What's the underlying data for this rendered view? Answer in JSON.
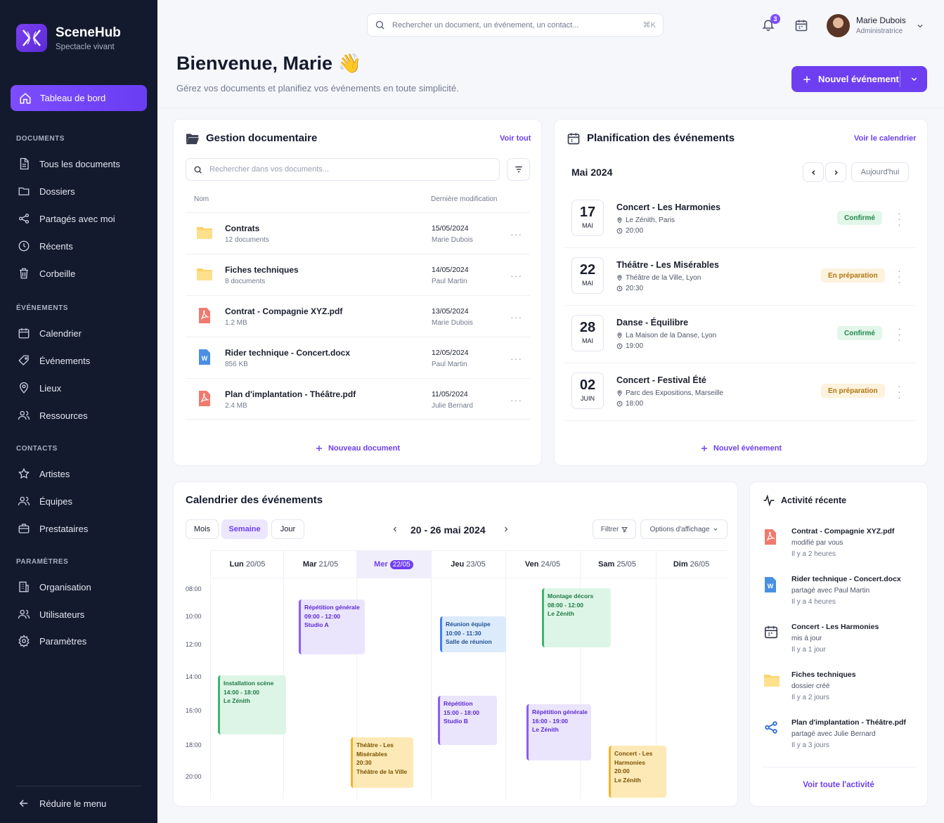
{
  "brand": {
    "name": "SceneHub",
    "subtitle": "Spectacle vivant"
  },
  "sidebar": {
    "active": "Tableau de bord",
    "sections": [
      {
        "title": "DOCUMENTS",
        "items": [
          "Tous les documents",
          "Dossiers",
          "Partagés avec moi",
          "Récents",
          "Corbeille"
        ]
      },
      {
        "title": "ÉVÉNEMENTS",
        "items": [
          "Calendrier",
          "Événements",
          "Lieux",
          "Ressources"
        ]
      },
      {
        "title": "CONTACTS",
        "items": [
          "Artistes",
          "Équipes",
          "Prestataires"
        ]
      },
      {
        "title": "PARAMÈTRES",
        "items": [
          "Organisation",
          "Utilisateurs",
          "Paramètres"
        ]
      }
    ],
    "collapse": "Réduire le menu"
  },
  "topbar": {
    "search_placeholder": "Rechercher un document, un événement, un contact...",
    "shortcut": "⌘K",
    "notifications": "3",
    "user_name": "Marie Dubois",
    "user_role": "Administratrice"
  },
  "header": {
    "welcome": "Bienvenue, Marie 👋",
    "subtitle": "Gérez vos documents et planifiez vos événements en toute simplicité.",
    "new_event": "Nouvel événement"
  },
  "documents": {
    "title": "Gestion documentaire",
    "view_all": "Voir tout",
    "search_placeholder": "Rechercher dans vos documents...",
    "col_name": "Nom",
    "col_modified": "Dernière modification",
    "rows": [
      {
        "name": "Contrats",
        "meta": "12 documents",
        "date": "15/05/2024",
        "user": "Marie Dubois",
        "type": "folder"
      },
      {
        "name": "Fiches techniques",
        "meta": "8 documents",
        "date": "14/05/2024",
        "user": "Paul Martin",
        "type": "folder"
      },
      {
        "name": "Contrat - Compagnie XYZ.pdf",
        "meta": "1.2 MB",
        "date": "13/05/2024",
        "user": "Marie Dubois",
        "type": "pdf"
      },
      {
        "name": "Rider technique - Concert.docx",
        "meta": "856 KB",
        "date": "12/05/2024",
        "user": "Paul Martin",
        "type": "word"
      },
      {
        "name": "Plan d'implantation - Théâtre.pdf",
        "meta": "2.4 MB",
        "date": "11/05/2024",
        "user": "Julie Bernard",
        "type": "pdf"
      }
    ],
    "new_doc": "Nouveau document"
  },
  "events": {
    "title": "Planification des événements",
    "view_calendar": "Voir le calendrier",
    "month": "Mai 2024",
    "today": "Aujourd'hui",
    "rows": [
      {
        "day": "17",
        "month": "MAI",
        "title": "Concert - Les Harmonies",
        "location": "Le Zénith, Paris",
        "time": "20:00",
        "status": "Confirmé",
        "status_type": "ok"
      },
      {
        "day": "22",
        "month": "MAI",
        "title": "Théâtre - Les Misérables",
        "location": "Théâtre de la Ville, Lyon",
        "time": "20:30",
        "status": "En préparation",
        "status_type": "prep"
      },
      {
        "day": "28",
        "month": "MAI",
        "title": "Danse - Équilibre",
        "location": "La Maison de la Danse, Lyon",
        "time": "19:00",
        "status": "Confirmé",
        "status_type": "ok"
      },
      {
        "day": "02",
        "month": "JUIN",
        "title": "Concert - Festival Été",
        "location": "Parc des Expositions, Marseille",
        "time": "18:00",
        "status": "En préparation",
        "status_type": "prep"
      }
    ],
    "new_event": "Nouvel événement"
  },
  "calendar": {
    "title": "Calendrier des événements",
    "views": [
      "Mois",
      "Semaine",
      "Jour"
    ],
    "active_view": "Semaine",
    "week": "20 - 26 mai 2024",
    "filter": "Filtrer",
    "display_options": "Options d'affichage",
    "days": [
      {
        "name": "Lun",
        "date": "20/05"
      },
      {
        "name": "Mar",
        "date": "21/05"
      },
      {
        "name": "Mer",
        "date": "22/05"
      },
      {
        "name": "Jeu",
        "date": "23/05"
      },
      {
        "name": "Ven",
        "date": "24/05"
      },
      {
        "name": "Sam",
        "date": "25/05"
      },
      {
        "name": "Dim",
        "date": "26/05"
      }
    ],
    "hours": [
      "08:00",
      "10:00",
      "12:00",
      "14:00",
      "16:00",
      "18:00",
      "20:00"
    ],
    "blocks": [
      {
        "lines": [
          "Répétition générale",
          "09:00 - 12:00",
          "Studio A"
        ],
        "color": "purple"
      },
      {
        "lines": [
          "Réunion équipe",
          "10:00 - 11:30",
          "Salle de réunion"
        ],
        "color": "blue"
      },
      {
        "lines": [
          "Montage décors",
          "08:00 - 12:00",
          "Le Zénith"
        ],
        "color": "green"
      },
      {
        "lines": [
          "Installation scène",
          "14:00 - 18:00",
          "Le Zénith"
        ],
        "color": "green"
      },
      {
        "lines": [
          "Répétition",
          "15:00 - 18:00",
          "Studio B"
        ],
        "color": "purple"
      },
      {
        "lines": [
          "Répétition générale",
          "16:00 - 19:00",
          "Le Zénith"
        ],
        "color": "purple"
      },
      {
        "lines": [
          "Théâtre - Les Misérables",
          "20:30",
          "Théâtre de la Ville"
        ],
        "color": "yellow"
      },
      {
        "lines": [
          "Concert - Les Harmonies",
          "20:00",
          "Le Zénith"
        ],
        "color": "yellow"
      }
    ]
  },
  "activity": {
    "title": "Activité récente",
    "items": [
      {
        "title": "Contrat - Compagnie XYZ.pdf",
        "desc": "modifié par vous",
        "time": "Il y a 2 heures",
        "icon": "pdf"
      },
      {
        "title": "Rider technique - Concert.docx",
        "desc": "partagé avec Paul Martin",
        "time": "Il y a 4 heures",
        "icon": "word"
      },
      {
        "title": "Concert - Les Harmonies",
        "desc": "mis à jour",
        "time": "Il y a 1 jour",
        "icon": "calendar"
      },
      {
        "title": "Fiches techniques",
        "desc": "dossier créé",
        "time": "Il y a 2 jours",
        "icon": "folder"
      },
      {
        "title": "Plan d'implantation - Théâtre.pdf",
        "desc": "partagé avec Julie Bernard",
        "time": "Il y a 3 jours",
        "icon": "share"
      }
    ],
    "view_all": "Voir toute l'activité"
  },
  "colors": {
    "accent": "#6e3ff0",
    "sidebar": "#141a2e"
  }
}
